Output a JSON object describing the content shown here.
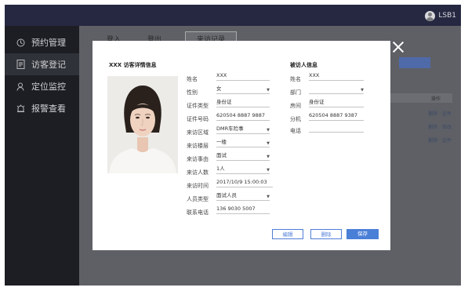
{
  "header": {
    "username": "LSB1"
  },
  "sidebar": {
    "items": [
      {
        "icon": "clock-icon",
        "label": "预约管理"
      },
      {
        "icon": "document-icon",
        "label": "访客登记"
      },
      {
        "icon": "person-location-icon",
        "label": "定位监控"
      },
      {
        "icon": "alarm-icon",
        "label": "报警查看"
      }
    ]
  },
  "background": {
    "tabs": [
      "登入",
      "登出",
      "来访记录"
    ],
    "table_header": "操作",
    "row_actions": [
      "删除 · 证件",
      "删除 · 修改",
      "删除 · 证件"
    ]
  },
  "modal": {
    "title": "XXX 访客详情信息",
    "visitor_fields": [
      {
        "label": "姓名",
        "value": "XXX",
        "dropdown": false
      },
      {
        "label": "性别",
        "value": "女",
        "dropdown": true
      },
      {
        "label": "证件类型",
        "value": "身份证",
        "dropdown": false
      },
      {
        "label": "证件号码",
        "value": "620504 8887 9887",
        "dropdown": false
      },
      {
        "label": "来访区域",
        "value": "DMR车险事",
        "dropdown": true
      },
      {
        "label": "来访楼层",
        "value": "一楼",
        "dropdown": true
      },
      {
        "label": "来访事由",
        "value": "面试",
        "dropdown": true
      },
      {
        "label": "来访人数",
        "value": "1人",
        "dropdown": true
      },
      {
        "label": "来访时间",
        "value": "2017/10/9 15:00:03",
        "dropdown": false
      },
      {
        "label": "人员类型",
        "value": "面试人员",
        "dropdown": true
      },
      {
        "label": "联系电话",
        "value": "136 9030 5007",
        "dropdown": false
      }
    ],
    "visited_title": "被访人信息",
    "visited_fields": [
      {
        "label": "姓名",
        "value": "XXX",
        "dropdown": false
      },
      {
        "label": "部门",
        "value": "",
        "dropdown": true
      },
      {
        "label": "房间",
        "value": "身份证",
        "dropdown": false
      },
      {
        "label": "分机",
        "value": "620504 8887 9387",
        "dropdown": false
      },
      {
        "label": "电话",
        "value": "",
        "dropdown": false
      }
    ],
    "buttons": {
      "cancel": "编辑",
      "modify": "删除",
      "save": "保存"
    }
  },
  "colors": {
    "primary": "#4a7fd8",
    "topbar": "#262842",
    "sidebar": "#1d1e24"
  }
}
